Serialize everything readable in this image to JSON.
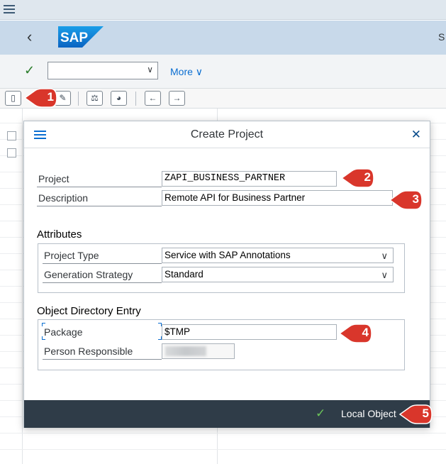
{
  "header": {
    "app_name_partial": "S"
  },
  "command_bar": {
    "command_value": "",
    "more_label": "More"
  },
  "dialog": {
    "title": "Create Project",
    "fields": {
      "project_label": "Project",
      "project_value": "ZAPI_BUSINESS_PARTNER",
      "description_label": "Description",
      "description_value": "Remote API for Business Partner"
    },
    "attributes": {
      "section_title": "Attributes",
      "project_type_label": "Project Type",
      "project_type_value": "Service with SAP Annotations",
      "generation_strategy_label": "Generation Strategy",
      "generation_strategy_value": "Standard"
    },
    "object_directory": {
      "section_title": "Object Directory Entry",
      "package_label": "Package",
      "package_value": "$TMP",
      "person_label": "Person Responsible"
    },
    "footer": {
      "local_object_label": "Local Object"
    }
  },
  "callouts": [
    "1",
    "2",
    "3",
    "4",
    "5"
  ],
  "colors": {
    "shell_bg": "#c8d9ea",
    "footer_bg": "#2f3c48",
    "callout_red": "#d9362b",
    "accent_blue": "#0a6ed1"
  }
}
